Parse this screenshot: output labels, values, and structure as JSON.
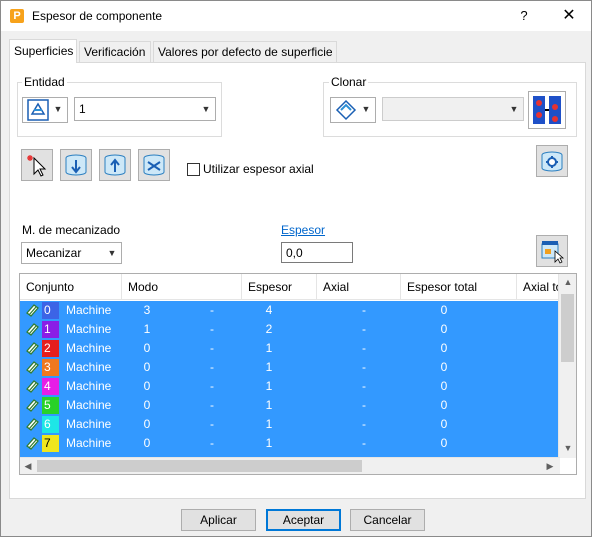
{
  "window": {
    "title": "Espesor de componente",
    "app_icon_letter": "P",
    "help_label": "?",
    "close_label": "✕"
  },
  "tabs": [
    {
      "label": "Superficies",
      "active": true
    },
    {
      "label": "Verificación",
      "active": false
    },
    {
      "label": "Valores por defecto de superficie",
      "active": false
    }
  ],
  "entidad": {
    "group_label": "Entidad",
    "value": "1"
  },
  "clonar": {
    "group_label": "Clonar",
    "value": ""
  },
  "axial_checkbox": {
    "label": "Utilizar espesor axial",
    "checked": false
  },
  "machining": {
    "label": "M. de mecanizado",
    "value": "Mecanizar"
  },
  "espesor": {
    "label": "Espesor",
    "value": "0,0"
  },
  "table": {
    "columns": [
      "Conjunto",
      "Modo",
      "Espesor",
      "Axial",
      "Espesor total",
      "Axial to"
    ],
    "rows": [
      {
        "set": "0",
        "color": "#3c64e6",
        "mode": "Machine",
        "modo": "3",
        "sep": "-",
        "espesor": "4",
        "axial": "-",
        "total": "0"
      },
      {
        "set": "1",
        "color": "#8a1ee6",
        "mode": "Machine",
        "modo": "1",
        "sep": "-",
        "espesor": "2",
        "axial": "-",
        "total": "0"
      },
      {
        "set": "2",
        "color": "#e61e1e",
        "mode": "Machine",
        "modo": "0",
        "sep": "-",
        "espesor": "1",
        "axial": "-",
        "total": "0"
      },
      {
        "set": "3",
        "color": "#f0781e",
        "mode": "Machine",
        "modo": "0",
        "sep": "-",
        "espesor": "1",
        "axial": "-",
        "total": "0"
      },
      {
        "set": "4",
        "color": "#e61ee6",
        "mode": "Machine",
        "modo": "0",
        "sep": "-",
        "espesor": "1",
        "axial": "-",
        "total": "0"
      },
      {
        "set": "5",
        "color": "#28d228",
        "mode": "Machine",
        "modo": "0",
        "sep": "-",
        "espesor": "1",
        "axial": "-",
        "total": "0"
      },
      {
        "set": "6",
        "color": "#1ee6e6",
        "mode": "Machine",
        "modo": "0",
        "sep": "-",
        "espesor": "1",
        "axial": "-",
        "total": "0"
      },
      {
        "set": "7",
        "color": "#f0e61e",
        "mode": "Machine",
        "modo": "0",
        "sep": "-",
        "espesor": "1",
        "axial": "-",
        "total": "0"
      }
    ]
  },
  "buttons": {
    "apply": "Aplicar",
    "accept": "Aceptar",
    "cancel": "Cancelar"
  },
  "colors": {
    "selection": "#3399ff",
    "link": "#0066cc",
    "app_icon": "#f7a21b"
  }
}
